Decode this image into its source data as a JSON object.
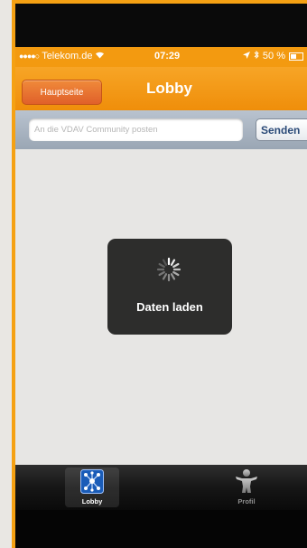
{
  "status_bar": {
    "carrier": "Telekom.de",
    "time": "07:29",
    "battery": "50 %"
  },
  "nav": {
    "back_label": "Hauptseite",
    "title": "Lobby"
  },
  "post": {
    "placeholder": "An die VDAV Community posten",
    "send_label": "Senden"
  },
  "loading": {
    "label": "Daten laden"
  },
  "tabs": [
    {
      "label": "Lobby",
      "icon": "lobby-network-icon",
      "selected": true
    },
    {
      "label": "Profil",
      "icon": "person-icon",
      "selected": false
    }
  ],
  "colors": {
    "accent_orange": "#f39a10",
    "frame_orange": "#f5a113",
    "back_button": "#e0602a"
  }
}
